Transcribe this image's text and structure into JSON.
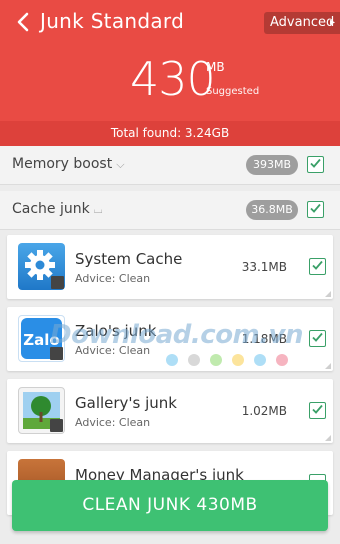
{
  "header": {
    "title": "Junk Standard",
    "advanced_label": "Advanced",
    "amount": "430",
    "unit": "MB",
    "suggested": "Suggested",
    "total_found": "Total found: 3.24GB"
  },
  "sections": {
    "memory_boost": {
      "label": "Memory boost",
      "size": "393MB",
      "checked": true
    },
    "cache_junk": {
      "label": "Cache junk",
      "size": "36.8MB",
      "checked": true
    }
  },
  "items": [
    {
      "name": "System Cache",
      "advice": "Advice: Clean",
      "size": "33.1MB",
      "icon": "gear-icon",
      "checked": true
    },
    {
      "name": "Zalo's junk",
      "advice": "Advice: Clean",
      "size": "1.18MB",
      "icon": "zalo-icon",
      "checked": true
    },
    {
      "name": "Gallery's junk",
      "advice": "Advice: Clean",
      "size": "1.02MB",
      "icon": "gallery-icon",
      "checked": true
    },
    {
      "name": "Money Manager's junk",
      "advice": "",
      "size": "",
      "icon": "money-manager-icon",
      "checked": true
    }
  ],
  "watermark": {
    "text": "Download.com.vn"
  },
  "clean_button": "CLEAN JUNK 430MB",
  "colors": {
    "header": "#e94b44",
    "accent_green": "#3ec173",
    "check_green": "#3aa068"
  }
}
